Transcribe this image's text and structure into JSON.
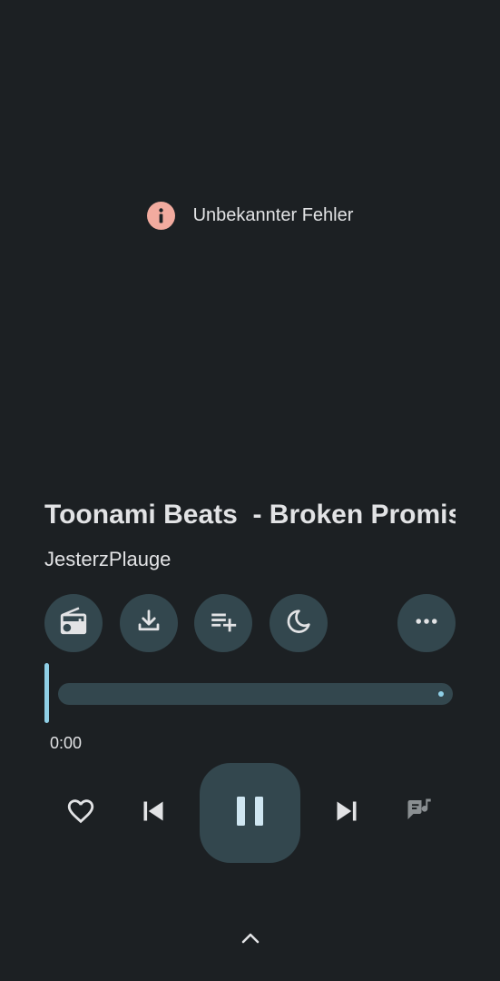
{
  "error": {
    "message": "Unbekannter Fehler",
    "icon": "info-icon",
    "icon_color": "#f2ab9f"
  },
  "track": {
    "title": "Toonami Beats  - Broken Promises",
    "artist": "JesterzPlauge"
  },
  "actions": [
    {
      "name": "radio-button",
      "icon": "radio-icon"
    },
    {
      "name": "download-button",
      "icon": "download-icon"
    },
    {
      "name": "add-to-queue-button",
      "icon": "playlist-add-icon"
    },
    {
      "name": "sleep-timer-button",
      "icon": "moon-icon"
    },
    {
      "name": "more-options-button",
      "icon": "more-horizontal-icon"
    }
  ],
  "progress": {
    "current_time": "0:00",
    "fraction": 0.0
  },
  "controls": {
    "like_icon": "heart-outline-icon",
    "previous_icon": "skip-previous-icon",
    "play_pause_icon": "pause-icon",
    "next_icon": "skip-next-icon",
    "lyrics_icon": "lyrics-icon"
  },
  "colors": {
    "background": "#1c2023",
    "surface": "#33474e",
    "accent": "#8fcfe6",
    "text": "#e2e3e5"
  }
}
